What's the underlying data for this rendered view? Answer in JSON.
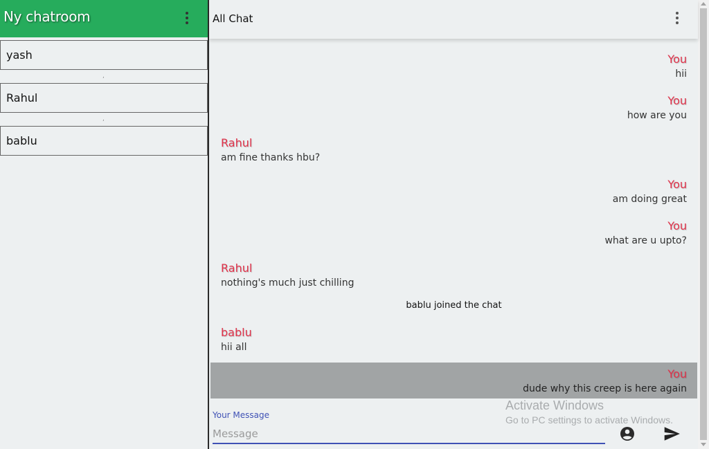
{
  "app": {
    "title": "Ny chatroom"
  },
  "users": [
    {
      "name": "yash"
    },
    {
      "name": "Rahul"
    },
    {
      "name": "bablu"
    }
  ],
  "user_separator": ",",
  "chat": {
    "title": "All Chat"
  },
  "messages": [
    {
      "sender": "You",
      "text": "hii"
    },
    {
      "sender": "You",
      "text": "how are you"
    },
    {
      "sender": "Rahul",
      "text": "am fine thanks hbu?"
    },
    {
      "sender": "You",
      "text": "am doing great"
    },
    {
      "sender": "You",
      "text": "what are u upto?"
    },
    {
      "sender": "Rahul",
      "text": "nothing's much just chilling"
    },
    {
      "sender": "bablu",
      "text": "hii all"
    },
    {
      "sender": "You",
      "text": "dude why this creep is here again"
    }
  ],
  "notice": {
    "text": "bablu joined the chat"
  },
  "composer": {
    "label": "Your Message",
    "placeholder": "Message",
    "value": ""
  },
  "watermark": {
    "title": "Activate Windows",
    "subtitle": "Go to PC settings to activate Windows."
  },
  "icons": {
    "menu": "more-vert-icon",
    "account": "account-circle-icon",
    "send": "send-icon"
  },
  "colors": {
    "header_green": "#26ac5c",
    "sender_red": "#e0324a",
    "input_blue": "#3f51b5",
    "highlight_gray": "#a1a4a5"
  }
}
